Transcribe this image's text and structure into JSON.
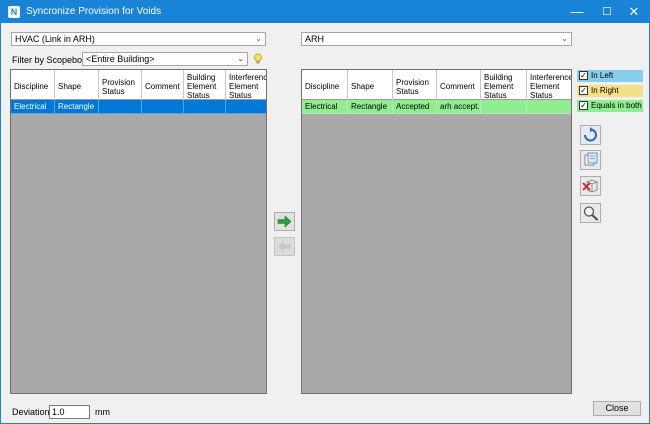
{
  "window": {
    "title": "Syncronize Provision for Voids",
    "icon_letter": "N",
    "controls": {
      "minimize": "—",
      "maximize": "☐",
      "close": "✕"
    }
  },
  "left_panel": {
    "source_combo": "HVAC (Link in ARH)",
    "filter_label": "Filter by Scopebox:",
    "scopebox_combo": "<Entire Building>",
    "columns": [
      "Discipline",
      "Shape",
      "Provision Status",
      "Comment",
      "Building Element Status",
      "Interference Element Status"
    ],
    "rows": [
      {
        "discipline": "Electrical",
        "shape": "Rectangle",
        "provision_status": "",
        "comment": "",
        "building_status": "",
        "interference_status": ""
      }
    ]
  },
  "right_panel": {
    "target_combo": "ARH",
    "columns": [
      "Discipline",
      "Shape",
      "Provision Status",
      "Comment",
      "Building Element Status",
      "Interference Element Status"
    ],
    "rows": [
      {
        "discipline": "Electrical",
        "shape": "Rectangle",
        "provision_status": "Accepted",
        "comment": "arh accept...",
        "building_status": "",
        "interference_status": ""
      }
    ]
  },
  "legend": {
    "in_left": {
      "label": "In Left",
      "color": "#87ceeb",
      "checked": "✓"
    },
    "in_right": {
      "label": "In Right",
      "color": "#f5e08a",
      "checked": "✓"
    },
    "equals_both": {
      "label": "Equals in both",
      "color": "#90ee90",
      "checked": "✓"
    }
  },
  "colors": {
    "titlebar": "#1883d7",
    "selected_row": "#0078d7",
    "equal_row": "#90ee90"
  },
  "footer": {
    "deviation_label": "Deviation:",
    "deviation_value": "1.0",
    "unit": "mm",
    "close_label": "Close"
  }
}
